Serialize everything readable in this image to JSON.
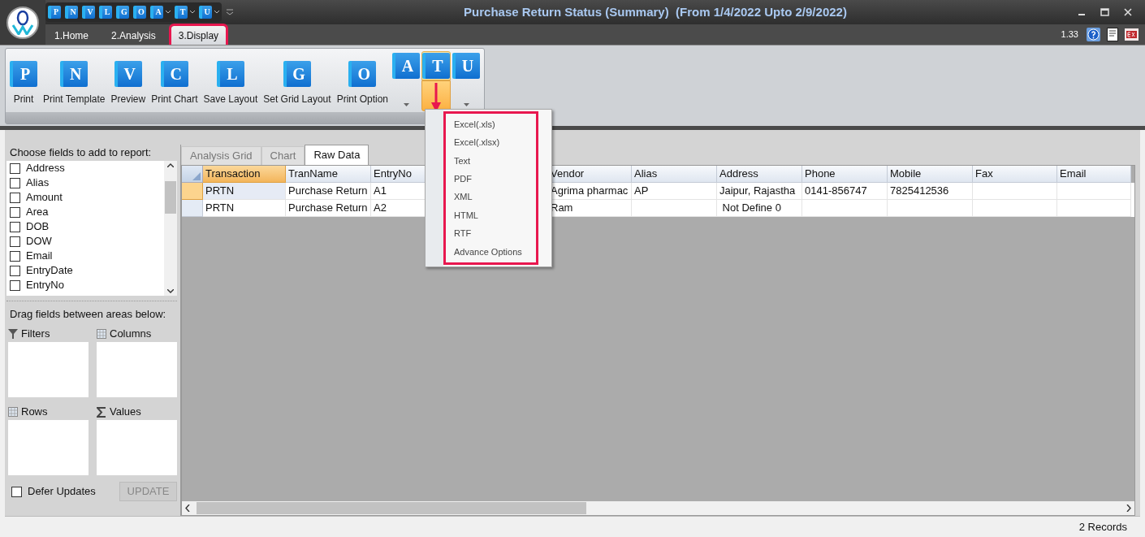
{
  "window": {
    "title": "Purchase Return Status (Summary)  (From 1/4/2022 Upto 2/9/2022)",
    "version": "1.33"
  },
  "quick_access": [
    {
      "letter": "P",
      "dropdown": false
    },
    {
      "letter": "N",
      "dropdown": false
    },
    {
      "letter": "V",
      "dropdown": false
    },
    {
      "letter": "L",
      "dropdown": false
    },
    {
      "letter": "G",
      "dropdown": false
    },
    {
      "letter": "O",
      "dropdown": false
    },
    {
      "letter": "A",
      "dropdown": true
    },
    {
      "letter": "T",
      "dropdown": true
    },
    {
      "letter": "U",
      "dropdown": true
    }
  ],
  "ribbon_tabs": [
    {
      "label": "1.Home",
      "selected": false,
      "highlighted": false
    },
    {
      "label": "2.Analysis",
      "selected": false,
      "highlighted": false
    },
    {
      "label": "3.Display",
      "selected": true,
      "highlighted": true
    }
  ],
  "ribbon_buttons": [
    {
      "kind": "labeled",
      "letter": "P",
      "label": "Print"
    },
    {
      "kind": "labeled",
      "letter": "N",
      "label": "Print Template"
    },
    {
      "kind": "labeled",
      "letter": "V",
      "label": "Preview"
    },
    {
      "kind": "labeled",
      "letter": "C",
      "label": "Print Chart"
    },
    {
      "kind": "labeled",
      "letter": "L",
      "label": "Save Layout"
    },
    {
      "kind": "labeled",
      "letter": "G",
      "label": "Set Grid Layout"
    },
    {
      "kind": "labeled",
      "letter": "O",
      "label": "Print Option"
    },
    {
      "kind": "split",
      "letter": "A",
      "expanded": false
    },
    {
      "kind": "split",
      "letter": "T",
      "expanded": true
    },
    {
      "kind": "split",
      "letter": "U",
      "expanded": false
    }
  ],
  "export_menu": {
    "highlighted": true,
    "items": [
      "Excel(.xls)",
      "Excel(.xlsx)",
      "Text",
      "PDF",
      "XML",
      "HTML",
      "RTF",
      "Advance Options"
    ]
  },
  "field_list": {
    "title": "Choose fields to add to report:",
    "fields": [
      {
        "label": "Address",
        "checked": false
      },
      {
        "label": "Alias",
        "checked": false
      },
      {
        "label": "Amount",
        "checked": false
      },
      {
        "label": "Area",
        "checked": false
      },
      {
        "label": "DOB",
        "checked": false
      },
      {
        "label": "DOW",
        "checked": false
      },
      {
        "label": "Email",
        "checked": false
      },
      {
        "label": "EntryDate",
        "checked": false
      },
      {
        "label": "EntryNo",
        "checked": false
      }
    ]
  },
  "areas": {
    "title": "Drag fields between areas below:",
    "zones": [
      {
        "kind": "filter",
        "label": "Filters"
      },
      {
        "kind": "grid",
        "label": "Columns"
      },
      {
        "kind": "grid",
        "label": "Rows"
      },
      {
        "kind": "sum",
        "label": "Values"
      }
    ]
  },
  "defer_updates": {
    "label": "Defer Updates",
    "checked": false
  },
  "update_button": {
    "label": "UPDATE",
    "disabled": true
  },
  "view_tabs": [
    {
      "label": "Analysis Grid",
      "selected": false
    },
    {
      "label": "Chart",
      "selected": false
    },
    {
      "label": "Raw Data",
      "selected": true
    }
  ],
  "table": {
    "columns": [
      {
        "label": "Transaction",
        "selected": true
      },
      {
        "label": "TranName",
        "selected": false
      },
      {
        "label": "EntryNo",
        "selected": false
      },
      {
        "label": "Vendor",
        "selected": false
      },
      {
        "label": "Alias",
        "selected": false
      },
      {
        "label": "Address",
        "selected": false
      },
      {
        "label": "Phone",
        "selected": false
      },
      {
        "label": "Mobile",
        "selected": false
      },
      {
        "label": "Fax",
        "selected": false
      },
      {
        "label": "Email",
        "selected": false
      }
    ],
    "rows": [
      {
        "selected": true,
        "cells": [
          "PRTN",
          "Purchase Return",
          "A1",
          "Agrima pharmac",
          "AP",
          "Jaipur, Rajastha",
          "0141-856747",
          "7825412536",
          null,
          null
        ]
      },
      {
        "selected": false,
        "cells": [
          "PRTN",
          "Purchase Return",
          "A2",
          "Ram",
          null,
          " Not Define 0",
          null,
          null,
          null,
          null
        ]
      }
    ]
  },
  "status_bar": {
    "text": "2 Records"
  }
}
